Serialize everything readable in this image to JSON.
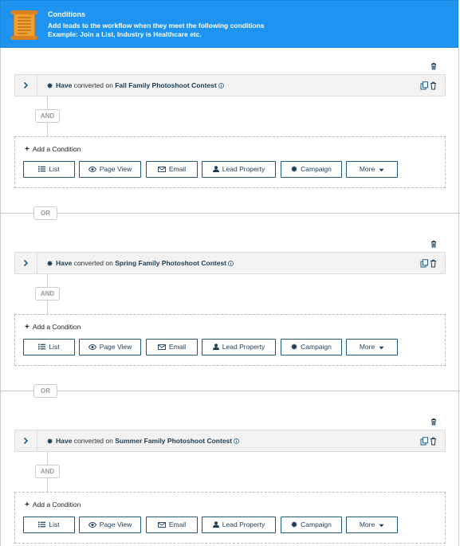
{
  "header": {
    "title": "Conditions",
    "subtitle": "Add leads to the workflow when they meet the following conditions",
    "example": "Example: Join a List, Industry is Healthcare etc.",
    "color": "#1e93f0"
  },
  "groups": [
    {
      "condition": {
        "verb": "Have",
        "action": "converted on",
        "target": "Fall Family Photoshoot Contest"
      },
      "and_label": "AND",
      "add_label": "Add a Condition"
    },
    {
      "condition": {
        "verb": "Have",
        "action": "converted on",
        "target": "Spring Family Photoshoot Contest"
      },
      "and_label": "AND",
      "add_label": "Add a Condition"
    },
    {
      "condition": {
        "verb": "Have",
        "action": "converted on",
        "target": "Summer Family Photoshoot Contest"
      },
      "and_label": "AND",
      "add_label": "Add a Condition"
    }
  ],
  "buttons": {
    "list": "List",
    "page_view": "Page View",
    "email": "Email",
    "lead_property": "Lead Property",
    "campaign": "Campaign",
    "more": "More"
  },
  "or_label": "OR",
  "icons": {
    "header": "scroll-document-icon",
    "row": [
      "chevron-right-icon",
      "campaign-dot-icon",
      "info-icon",
      "copy-icon",
      "trash-icon"
    ],
    "buttons": [
      "list-icon",
      "eye-icon",
      "envelope-icon",
      "user-icon",
      "campaign-icon",
      "caret-down-icon"
    ]
  }
}
